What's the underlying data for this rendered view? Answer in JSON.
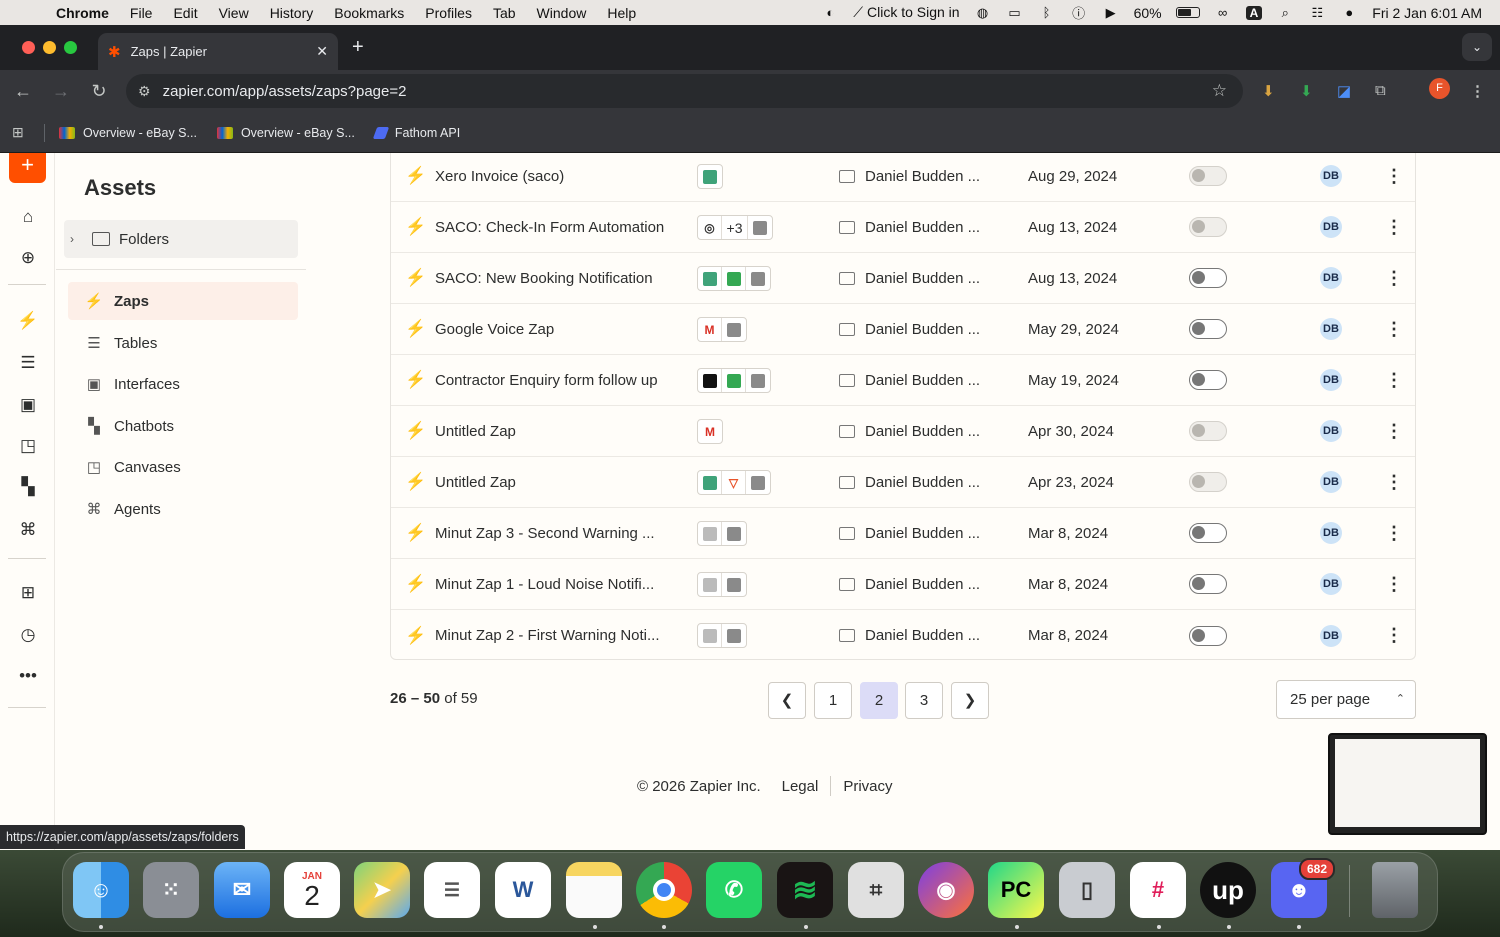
{
  "menubar": {
    "items": [
      "Chrome",
      "File",
      "Edit",
      "View",
      "History",
      "Bookmarks",
      "Profiles",
      "Tab",
      "Window",
      "Help"
    ],
    "sign_in": "Click to Sign in",
    "battery": "60%",
    "keyboard": "A",
    "datetime": "Fri 2 Jan  6:01 AM"
  },
  "browser": {
    "tab_title": "Zaps | Zapier",
    "url": "zapier.com/app/assets/zaps?page=2",
    "profile_initial": "F",
    "bookmarks": [
      {
        "label": "Overview - eBay S..."
      },
      {
        "label": "Overview - eBay S..."
      },
      {
        "label": "Fathom API"
      }
    ],
    "status_url": "https://zapier.com/app/assets/zaps/folders"
  },
  "sidebar": {
    "heading": "Assets",
    "folders_label": "Folders",
    "nav": [
      {
        "label": "Zaps",
        "icon": "zap-icon",
        "glyph": "⚡",
        "active": true
      },
      {
        "label": "Tables",
        "icon": "tables-icon",
        "glyph": "☰",
        "active": false
      },
      {
        "label": "Interfaces",
        "icon": "interfaces-icon",
        "glyph": "▣",
        "active": false
      },
      {
        "label": "Chatbots",
        "icon": "chatbots-icon",
        "glyph": "▚",
        "active": false
      },
      {
        "label": "Canvases",
        "icon": "canvases-icon",
        "glyph": "◳",
        "active": false
      },
      {
        "label": "Agents",
        "icon": "agents-icon",
        "glyph": "⌘",
        "active": false
      }
    ]
  },
  "zaps": [
    {
      "name": "Xero Invoice (saco)",
      "apps": [
        {
          "c": "#3fa37a"
        }
      ],
      "owner": "Daniel Budden ...",
      "date": "Aug 29, 2024",
      "status": "disabled",
      "owner_initials": "DB"
    },
    {
      "name": "SACO: Check-In Form Automation",
      "apps": [
        {
          "c": "#e8542b",
          "t": "◎"
        },
        {
          "plus": "+3"
        },
        {
          "c": "#8a8a8a"
        }
      ],
      "owner": "Daniel Budden ...",
      "date": "Aug 13, 2024",
      "status": "disabled",
      "owner_initials": "DB"
    },
    {
      "name": "SACO: New Booking Notification",
      "apps": [
        {
          "c": "#3fa37a"
        },
        {
          "c": "#34a853"
        },
        {
          "c": "#8a8a8a"
        }
      ],
      "owner": "Daniel Budden ...",
      "date": "Aug 13, 2024",
      "status": "off",
      "owner_initials": "DB"
    },
    {
      "name": "Google Voice Zap",
      "apps": [
        {
          "t": "M",
          "tc": "#d93025"
        },
        {
          "c": "#8a8a8a"
        }
      ],
      "owner": "Daniel Budden ...",
      "date": "May 29, 2024",
      "status": "off",
      "owner_initials": "DB"
    },
    {
      "name": "Contractor Enquiry form follow up",
      "apps": [
        {
          "c": "#111"
        },
        {
          "c": "#34a853"
        },
        {
          "c": "#8a8a8a"
        }
      ],
      "owner": "Daniel Budden ...",
      "date": "May 19, 2024",
      "status": "off",
      "owner_initials": "DB"
    },
    {
      "name": "Untitled Zap",
      "apps": [
        {
          "t": "M",
          "tc": "#d93025"
        }
      ],
      "owner": "Daniel Budden ...",
      "date": "Apr 30, 2024",
      "status": "disabled",
      "owner_initials": "DB"
    },
    {
      "name": "Untitled Zap",
      "apps": [
        {
          "c": "#3fa37a"
        },
        {
          "t": "▽",
          "tc": "#e8542b"
        },
        {
          "c": "#8a8a8a"
        }
      ],
      "owner": "Daniel Budden ...",
      "date": "Apr 23, 2024",
      "status": "disabled",
      "owner_initials": "DB"
    },
    {
      "name": "Minut Zap 3 - Second Warning ...",
      "apps": [
        {
          "c": "#bbb"
        },
        {
          "c": "#8a8a8a"
        }
      ],
      "owner": "Daniel Budden ...",
      "date": "Mar 8, 2024",
      "status": "off",
      "owner_initials": "DB"
    },
    {
      "name": "Minut Zap 1 - Loud Noise Notifi...",
      "apps": [
        {
          "c": "#bbb"
        },
        {
          "c": "#8a8a8a"
        }
      ],
      "owner": "Daniel Budden ...",
      "date": "Mar 8, 2024",
      "status": "off",
      "owner_initials": "DB"
    },
    {
      "name": "Minut Zap 2 - First Warning Noti...",
      "apps": [
        {
          "c": "#bbb"
        },
        {
          "c": "#8a8a8a"
        }
      ],
      "owner": "Daniel Budden ...",
      "date": "Mar 8, 2024",
      "status": "off",
      "owner_initials": "DB"
    }
  ],
  "pagination": {
    "range_start": "26",
    "range_sep": " – ",
    "range_end": "50",
    "of_text": " of 59",
    "pages": [
      "1",
      "2",
      "3"
    ],
    "current_page": "2",
    "per_page": "25 per page"
  },
  "footer": {
    "copyright": "© 2026 Zapier Inc.",
    "legal": "Legal",
    "privacy": "Privacy"
  },
  "dock": {
    "calendar_month": "JAN",
    "calendar_day": "2",
    "discord_badge": "682"
  },
  "colors": {
    "accent": "#ff4f00",
    "active_page": "#dcdcf7"
  }
}
